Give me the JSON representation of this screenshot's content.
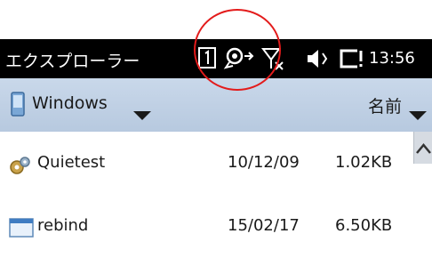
{
  "titlebar": {
    "title": "エクスプローラー",
    "clock": "13:56",
    "icons": [
      "sim-icon",
      "activesync-icon",
      "no-signal-icon",
      "volume-icon",
      "battery-icon"
    ]
  },
  "header": {
    "folder_label": "Windows",
    "sort_label": "名前"
  },
  "files": [
    {
      "name": "Quietest",
      "date": "10/12/09",
      "size": "1.02KB",
      "icon": "config-file-icon"
    },
    {
      "name": "rebind",
      "date": "15/02/17",
      "size": "6.50KB",
      "icon": "file-icon"
    }
  ],
  "colors": {
    "titlebar": "#000000",
    "header": "#c2d3e8",
    "annotation": "#e31b1b"
  }
}
